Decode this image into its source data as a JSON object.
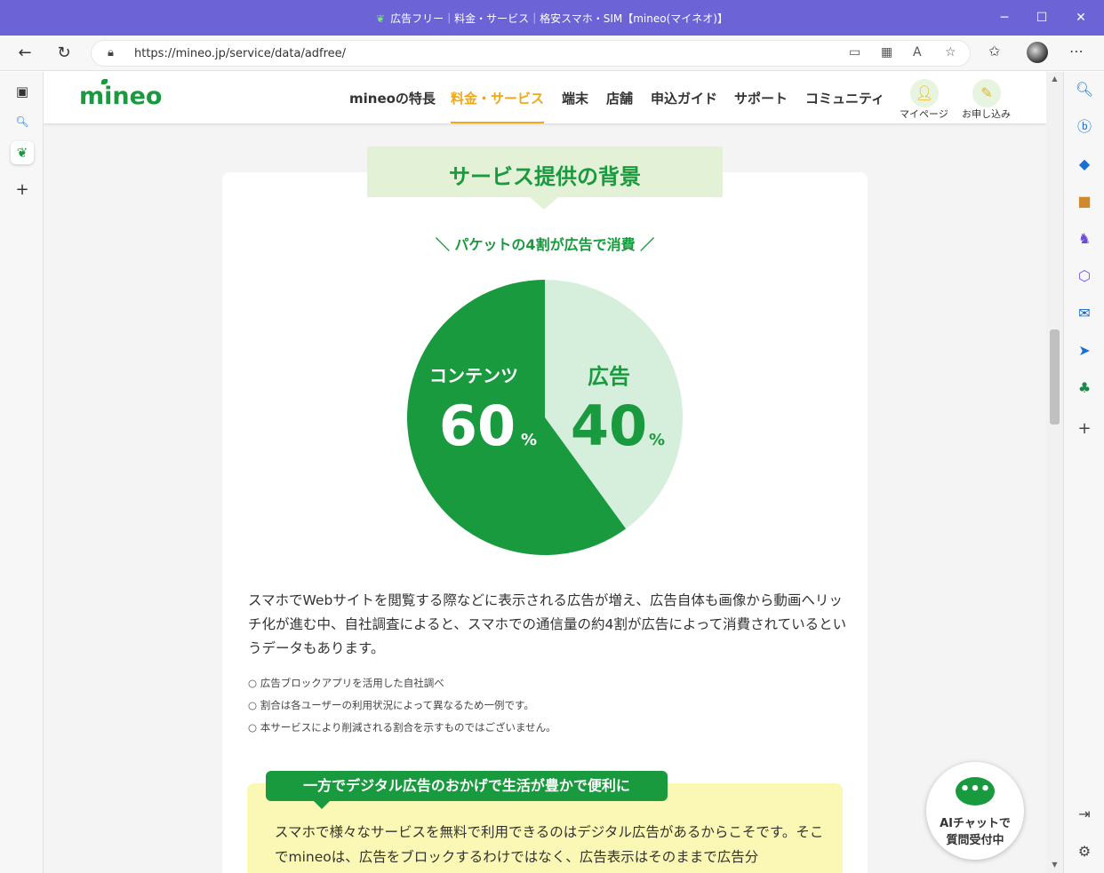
{
  "window": {
    "title": "広告フリー｜料金・サービス｜格安スマホ・SIM【mineo(マイネオ)】"
  },
  "browser": {
    "url": "https://mineo.jp/service/data/adfree/"
  },
  "site": {
    "logo": "mineo",
    "nav": [
      "mineoの特長",
      "料金・サービス",
      "端末",
      "店舗",
      "申込ガイド",
      "サポート",
      "コミュニティ"
    ],
    "mypage_label": "マイページ",
    "apply_label": "お申し込み"
  },
  "section": {
    "heading": "サービス提供の背景",
    "subheading": "＼ パケットの4割が広告で消費 ／"
  },
  "chart_data": {
    "type": "pie",
    "slices": [
      {
        "name": "コンテンツ",
        "value": 60,
        "color": "#1a9a3e"
      },
      {
        "name": "広告",
        "value": 40,
        "color": "#d6eedc"
      }
    ],
    "labels": {
      "content_name": "コンテンツ",
      "content_value": "60",
      "content_unit": "%",
      "ad_name": "広告",
      "ad_value": "40",
      "ad_unit": "%"
    }
  },
  "body": {
    "paragraph": "スマホでWebサイトを閲覧する際などに表示される広告が増え、広告自体も画像から動画へリッチ化が進む中、自社調査によると、スマホでの通信量の約4割が広告によって消費されているというデータもあります。",
    "notes": [
      "○ 広告ブロックアプリを活用した自社調べ",
      "○ 割合は各ユーザーの利用状況によって異なるため一例です。",
      "○ 本サービスにより削減される割合を示すものではございません。"
    ]
  },
  "callout": {
    "tag": "一方でデジタル広告のおかげで生活が豊かで便利に",
    "text": "スマホで様々なサービスを無料で利用できるのはデジタル広告があるからこそです。そこでmineoは、広告をブロックするわけではなく、広告表示はそのままで広告分"
  },
  "chat": {
    "line1": "AIチャットで",
    "line2": "質問受付中"
  },
  "colors": {
    "brand_green": "#1a9a3e",
    "accent_orange": "#f0a818",
    "title_bar": "#6b63d6"
  }
}
